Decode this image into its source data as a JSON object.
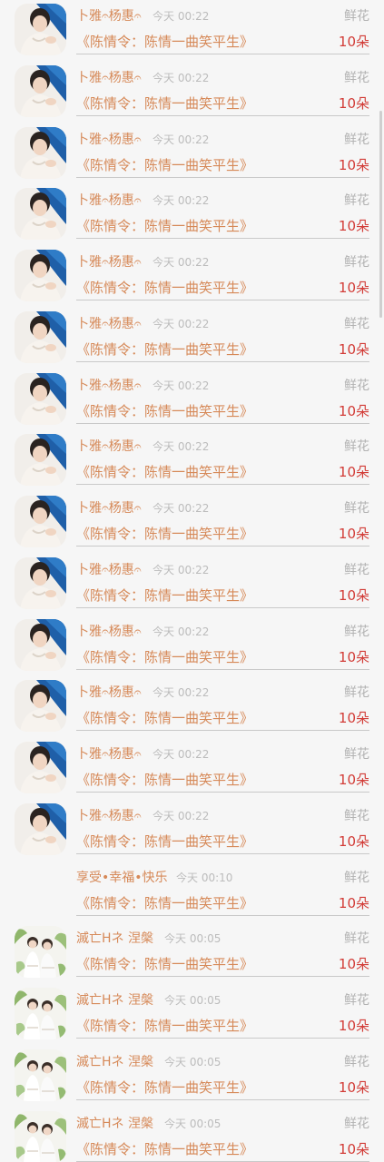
{
  "rows": [
    {
      "name": "卜雅𝄐杨惠𝄐",
      "time": "今天 00:22",
      "gift": "鲜花",
      "work": "《陈情令：陈情一曲笑平生》",
      "count": "10朵",
      "avatar": "man-portrait-avatar"
    },
    {
      "name": "卜雅𝄐杨惠𝄐",
      "time": "今天 00:22",
      "gift": "鲜花",
      "work": "《陈情令：陈情一曲笑平生》",
      "count": "10朵",
      "avatar": "man-portrait-avatar"
    },
    {
      "name": "卜雅𝄐杨惠𝄐",
      "time": "今天 00:22",
      "gift": "鲜花",
      "work": "《陈情令：陈情一曲笑平生》",
      "count": "10朵",
      "avatar": "man-portrait-avatar"
    },
    {
      "name": "卜雅𝄐杨惠𝄐",
      "time": "今天 00:22",
      "gift": "鲜花",
      "work": "《陈情令：陈情一曲笑平生》",
      "count": "10朵",
      "avatar": "man-portrait-avatar"
    },
    {
      "name": "卜雅𝄐杨惠𝄐",
      "time": "今天 00:22",
      "gift": "鲜花",
      "work": "《陈情令：陈情一曲笑平生》",
      "count": "10朵",
      "avatar": "man-portrait-avatar"
    },
    {
      "name": "卜雅𝄐杨惠𝄐",
      "time": "今天 00:22",
      "gift": "鲜花",
      "work": "《陈情令：陈情一曲笑平生》",
      "count": "10朵",
      "avatar": "man-portrait-avatar"
    },
    {
      "name": "卜雅𝄐杨惠𝄐",
      "time": "今天 00:22",
      "gift": "鲜花",
      "work": "《陈情令：陈情一曲笑平生》",
      "count": "10朵",
      "avatar": "man-portrait-avatar"
    },
    {
      "name": "卜雅𝄐杨惠𝄐",
      "time": "今天 00:22",
      "gift": "鲜花",
      "work": "《陈情令：陈情一曲笑平生》",
      "count": "10朵",
      "avatar": "man-portrait-avatar"
    },
    {
      "name": "卜雅𝄐杨惠𝄐",
      "time": "今天 00:22",
      "gift": "鲜花",
      "work": "《陈情令：陈情一曲笑平生》",
      "count": "10朵",
      "avatar": "man-portrait-avatar"
    },
    {
      "name": "卜雅𝄐杨惠𝄐",
      "time": "今天 00:22",
      "gift": "鲜花",
      "work": "《陈情令：陈情一曲笑平生》",
      "count": "10朵",
      "avatar": "man-portrait-avatar"
    },
    {
      "name": "卜雅𝄐杨惠𝄐",
      "time": "今天 00:22",
      "gift": "鲜花",
      "work": "《陈情令：陈情一曲笑平生》",
      "count": "10朵",
      "avatar": "man-portrait-avatar"
    },
    {
      "name": "卜雅𝄐杨惠𝄐",
      "time": "今天 00:22",
      "gift": "鲜花",
      "work": "《陈情令：陈情一曲笑平生》",
      "count": "10朵",
      "avatar": "man-portrait-avatar"
    },
    {
      "name": "卜雅𝄐杨惠𝄐",
      "time": "今天 00:22",
      "gift": "鲜花",
      "work": "《陈情令：陈情一曲笑平生》",
      "count": "10朵",
      "avatar": "man-portrait-avatar"
    },
    {
      "name": "卜雅𝄐杨惠𝄐",
      "time": "今天 00:22",
      "gift": "鲜花",
      "work": "《陈情令：陈情一曲笑平生》",
      "count": "10朵",
      "avatar": "man-portrait-avatar"
    },
    {
      "name": "享受•幸福•快乐",
      "time": "今天 00:10",
      "gift": "鲜花",
      "work": "《陈情令：陈情一曲笑平生》",
      "count": "10朵",
      "avatar": "none"
    },
    {
      "name": "滅亡Hネ 涅槃",
      "time": "今天 00:05",
      "gift": "鲜花",
      "work": "《陈情令：陈情一曲笑平生》",
      "count": "10朵",
      "avatar": "group-portrait-avatar"
    },
    {
      "name": "滅亡Hネ 涅槃",
      "time": "今天 00:05",
      "gift": "鲜花",
      "work": "《陈情令：陈情一曲笑平生》",
      "count": "10朵",
      "avatar": "group-portrait-avatar"
    },
    {
      "name": "滅亡Hネ 涅槃",
      "time": "今天 00:05",
      "gift": "鲜花",
      "work": "《陈情令：陈情一曲笑平生》",
      "count": "10朵",
      "avatar": "group-portrait-avatar"
    },
    {
      "name": "滅亡Hネ 涅槃",
      "time": "今天 00:05",
      "gift": "鲜花",
      "work": "《陈情令：陈情一曲笑平生》",
      "count": "10朵",
      "avatar": "group-portrait-avatar"
    }
  ],
  "colors": {
    "background": "#f6f6f6",
    "name": "#d68958",
    "time": "#bcbcbc",
    "gift": "#b2b2b2",
    "count": "#d23c37",
    "divider": "#c9c9c9"
  }
}
